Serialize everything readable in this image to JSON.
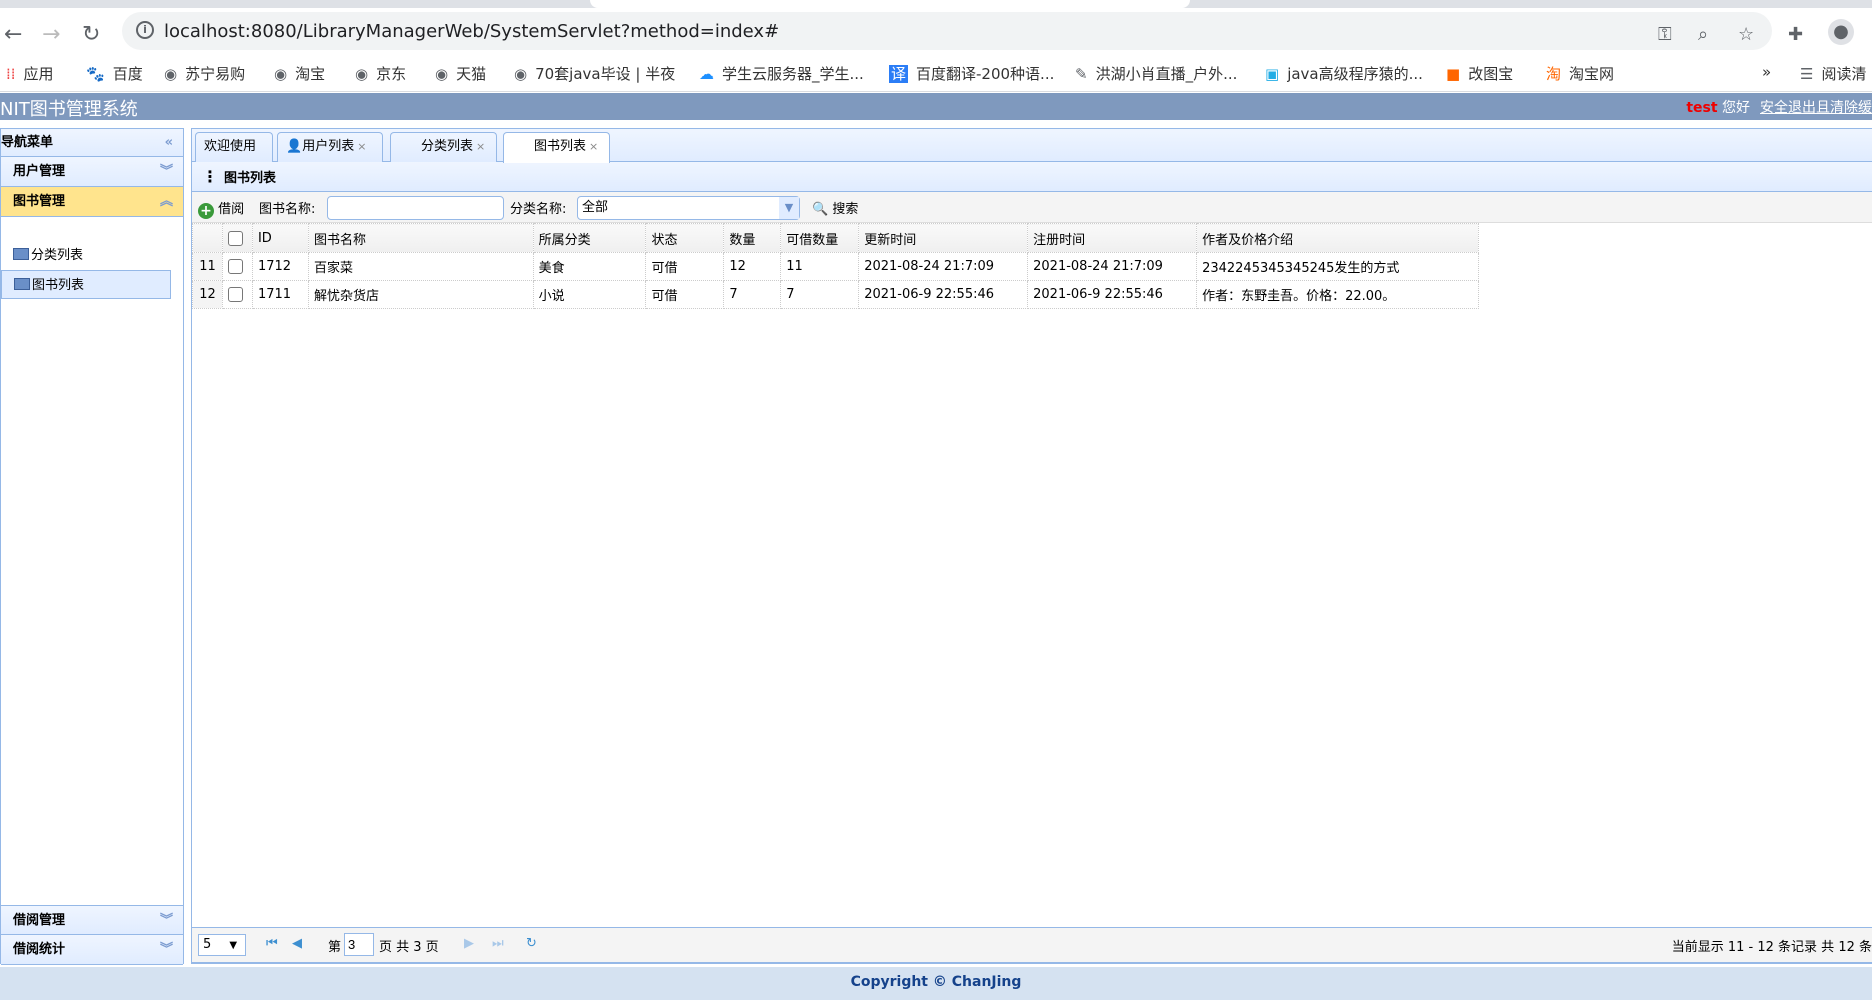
{
  "browser": {
    "url": "localhost:8080/LibraryManagerWeb/SystemServlet?method=index#",
    "bookmarks": [
      "应用",
      "百度",
      "苏宁易购",
      "淘宝",
      "京东",
      "天猫",
      "70套java毕设 | 半夜",
      "学生云服务器_学生...",
      "百度翻译-200种语...",
      "洪湖小肖直播_户外...",
      "java高级程序猿的...",
      "改图宝",
      "淘宝网"
    ],
    "more": "»",
    "reading_list": "阅读清"
  },
  "app": {
    "title": "NIT图书管理系统",
    "user": "test",
    "greeting": "您好",
    "logout": "安全退出且清除缓"
  },
  "sidebar": {
    "title": "导航菜单",
    "sections": [
      {
        "label": "用户管理"
      },
      {
        "label": "图书管理",
        "items": [
          "分类列表",
          "图书列表"
        ]
      },
      {
        "label": "借阅管理"
      },
      {
        "label": "借阅统计"
      }
    ]
  },
  "tabs": [
    {
      "label": "欢迎使用"
    },
    {
      "label": "用户列表",
      "close": "×"
    },
    {
      "label": "分类列表",
      "close": "×"
    },
    {
      "label": "图书列表",
      "close": "×"
    }
  ],
  "panel": {
    "title": "图书列表"
  },
  "toolbar": {
    "borrow": "借阅",
    "name_label": "图书名称:",
    "name_value": "",
    "cat_label": "分类名称:",
    "cat_value": "全部",
    "search": "搜索"
  },
  "grid": {
    "columns": [
      "ID",
      "图书名称",
      "所属分类",
      "状态",
      "数量",
      "可借数量",
      "更新时间",
      "注册时间",
      "作者及价格介绍"
    ],
    "rows": [
      {
        "rn": "11",
        "cells": [
          "1712",
          "百家菜",
          "美食",
          "可借",
          "12",
          "11",
          "2021-08-24 21:7:09",
          "2021-08-24 21:7:09",
          "2342245345345245发生的方式"
        ]
      },
      {
        "rn": "12",
        "cells": [
          "1711",
          "解忧杂货店",
          "小说",
          "可借",
          "7",
          "7",
          "2021-06-9 22:55:46",
          "2021-06-9 22:55:46",
          "作者：东野圭吾。价格：22.00。"
        ]
      }
    ]
  },
  "pager": {
    "page_size": "5",
    "page_prefix": "第",
    "page": "3",
    "page_suffix": "页 共 3 页",
    "info": "当前显示 11 - 12 条记录 共 12 条"
  },
  "footer": {
    "copyright": "Copyright © ChanJing"
  }
}
